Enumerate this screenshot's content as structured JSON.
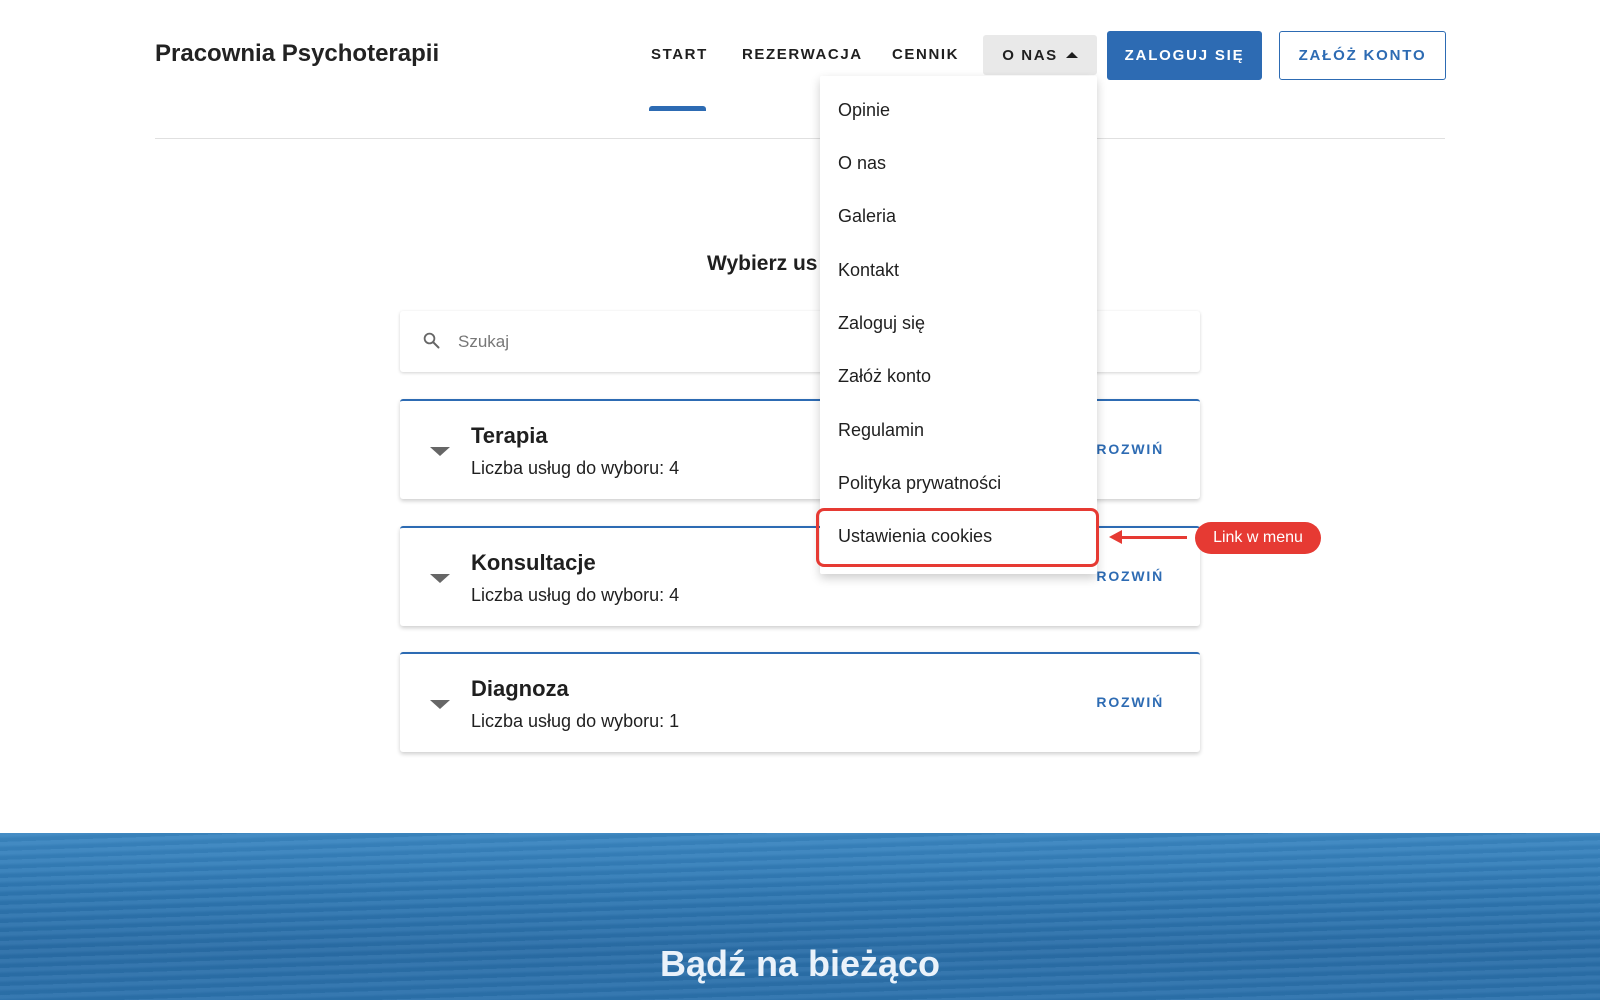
{
  "header": {
    "brand": "Pracownia Psychoterapii",
    "nav": [
      {
        "label": "START"
      },
      {
        "label": "REZERWACJA"
      },
      {
        "label": "CENNIK"
      },
      {
        "label": "O NAS"
      }
    ],
    "login_button": "ZALOGUJ SIĘ",
    "register_button": "ZAŁÓŻ KONTO"
  },
  "dropdown": {
    "items": [
      {
        "label": "Opinie"
      },
      {
        "label": "O nas"
      },
      {
        "label": "Galeria"
      },
      {
        "label": "Kontakt"
      },
      {
        "label": "Zaloguj się"
      },
      {
        "label": "Załóż konto"
      },
      {
        "label": "Regulamin"
      },
      {
        "label": "Polityka prywatności"
      },
      {
        "label": "Ustawienia cookies"
      }
    ]
  },
  "annotation": {
    "label": "Link w menu",
    "color": "#e63a33"
  },
  "services": {
    "title_visible": "Wybierz us",
    "search_placeholder": "Szukaj",
    "expand_label": "ROZWIŃ",
    "categories": [
      {
        "name": "Terapia",
        "count_text": "Liczba usług do wyboru: 4"
      },
      {
        "name": "Konsultacje",
        "count_text": "Liczba usług do wyboru: 4"
      },
      {
        "name": "Diagnoza",
        "count_text": "Liczba usług do wyboru: 1"
      }
    ]
  },
  "footer_banner": {
    "title": "Bądź na bieżąco"
  },
  "colors": {
    "accent": "#2d6bb3",
    "annotation": "#e63a33"
  }
}
